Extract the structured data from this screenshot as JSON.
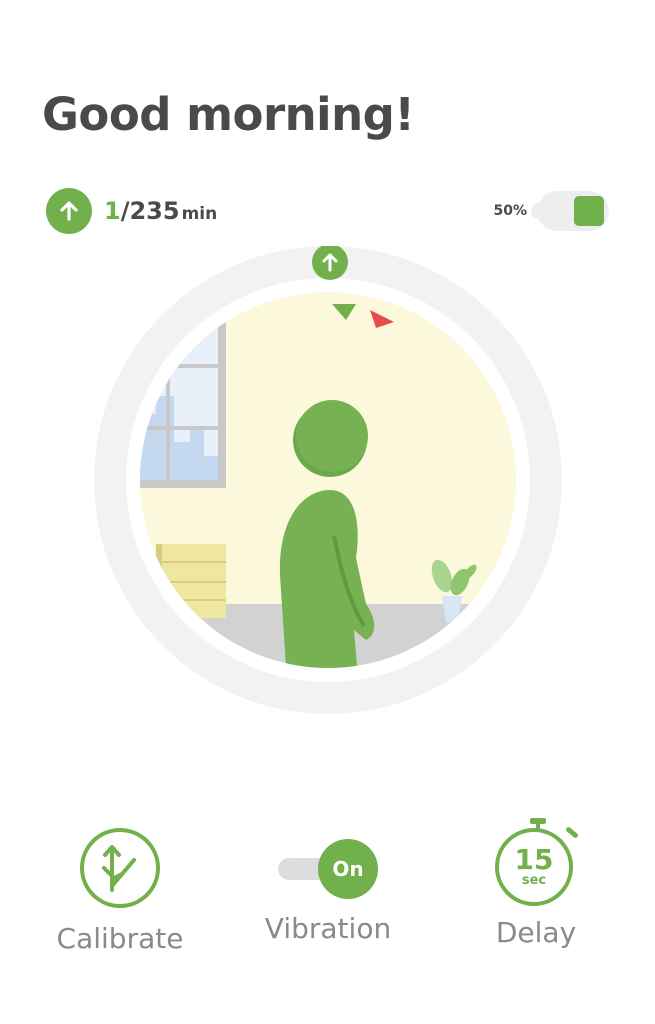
{
  "greeting": "Good morning!",
  "stats": {
    "current": "1",
    "separator": "/",
    "total": "235",
    "unit": "min"
  },
  "battery": {
    "percent_label": "50%"
  },
  "controls": {
    "calibrate_label": "Calibrate",
    "vibration_label": "Vibration",
    "vibration_state": "On",
    "delay_label": "Delay",
    "delay_value": "15",
    "delay_unit": "sec"
  },
  "colors": {
    "accent": "#72b04b",
    "text": "#4a4a4a",
    "muted": "#8a8a8a",
    "warning": "#e84c4c",
    "wall": "#fbf8dc"
  },
  "icons": {
    "stand": "arrow-up-icon",
    "calibrate": "calibrate-icon",
    "delay": "stopwatch-icon"
  }
}
